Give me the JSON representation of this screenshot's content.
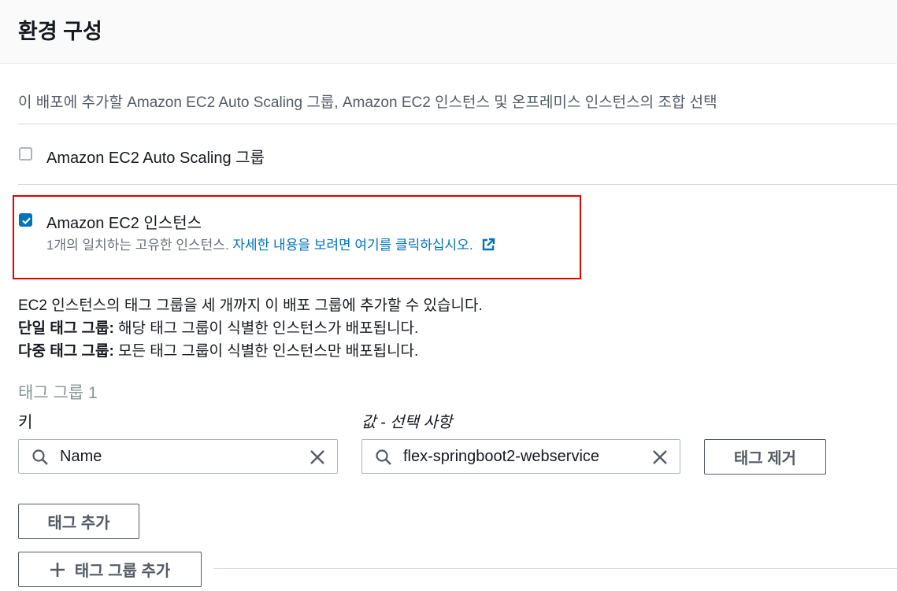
{
  "header": {
    "title": "환경 구성"
  },
  "description": "이 배포에 추가할 Amazon EC2 Auto Scaling 그룹, Amazon EC2 인스턴스 및 온프레미스 인스턴스의 조합 선택",
  "options": {
    "auto_scaling": {
      "label": "Amazon EC2 Auto Scaling 그룹",
      "checked": false
    },
    "ec2_instances": {
      "label": "Amazon EC2 인스턴스",
      "checked": true,
      "match_text": "1개의 일치하는 고유한 인스턴스.",
      "link_text": "자세한 내용을 보려면 여기를 클릭하십시오."
    }
  },
  "info": {
    "line1": "EC2 인스턴스의 태그 그룹을 세 개까지 이 배포 그룹에 추가할 수 있습니다.",
    "single_label": "단일 태그 그룹:",
    "single_text": " 해당 태그 그룹이 식별한 인스턴스가 배포됩니다.",
    "multi_label": "다중 태그 그룹:",
    "multi_text": " 모든 태그 그룹이 식별한 인스턴스만 배포됩니다."
  },
  "tag_group": {
    "title": "태그 그룹 1",
    "key_label": "키",
    "value_label": "값 - 선택 사항",
    "key_value": "Name",
    "value_value": "flex-springboot2-webservice",
    "remove_tag_label": "태그 제거",
    "add_tag_label": "태그 추가"
  },
  "add_tag_group_label": "태그 그룹 추가",
  "colors": {
    "accent": "#0073bb",
    "highlight": "#e00000",
    "border": "#aab7b8"
  }
}
